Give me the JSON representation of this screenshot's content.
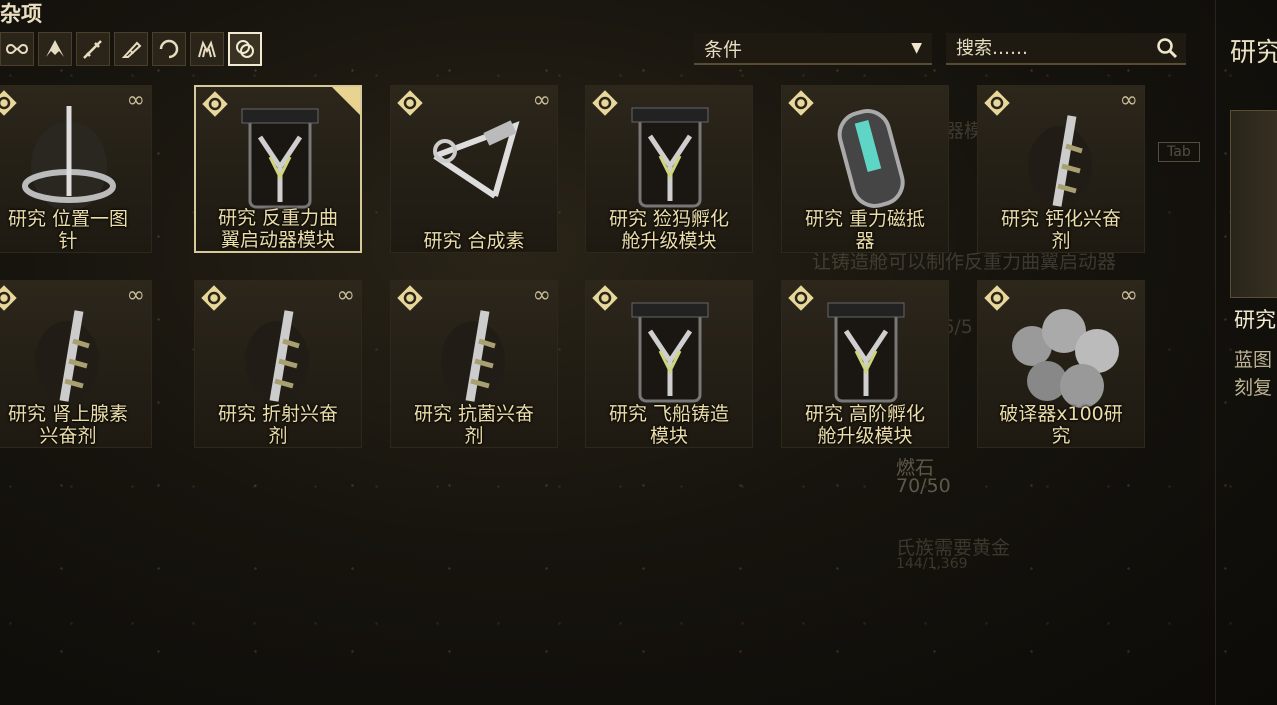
{
  "header": {
    "title": "杂项"
  },
  "filters": [
    {
      "icon": "infinity-icon"
    },
    {
      "icon": "warframe-icon"
    },
    {
      "icon": "primary-weapon-icon"
    },
    {
      "icon": "secondary-weapon-icon"
    },
    {
      "icon": "melee-weapon-icon"
    },
    {
      "icon": "companion-icon"
    },
    {
      "icon": "misc-items-icon",
      "active": true
    }
  ],
  "condition": {
    "label": "条件",
    "arrow": "▼"
  },
  "search": {
    "placeholder": "搜索……"
  },
  "items": [
    {
      "label": "研究  位置一图\n针",
      "art": "beacon-art",
      "infinite": true
    },
    {
      "label": "研究  反重力曲\n翼启动器模块",
      "art": "module-art",
      "infinite": false,
      "selected": true
    },
    {
      "label": "研究  合成素",
      "art": "synthesis-art",
      "infinite": true
    },
    {
      "label": "研究  猃犸孵化\n舱升级模块",
      "art": "module-art",
      "infinite": false
    },
    {
      "label": "研究  重力磁抵\n器",
      "art": "capsule-art",
      "infinite": false
    },
    {
      "label": "研究  钙化兴奋\n剂",
      "art": "syringe-art",
      "infinite": true
    },
    {
      "label": "研究  肾上腺素\n兴奋剂",
      "art": "syringe-art",
      "infinite": true
    },
    {
      "label": "研究  折射兴奋\n剂",
      "art": "syringe-art",
      "infinite": true
    },
    {
      "label": "研究  抗菌兴奋\n剂",
      "art": "syringe-art",
      "infinite": true
    },
    {
      "label": "研究  飞船铸造\n模块",
      "art": "module-art",
      "infinite": false
    },
    {
      "label": "研究  高阶孵化\n舱升级模块",
      "art": "module-art",
      "infinite": false
    },
    {
      "label": "破译器x100研\n究",
      "art": "cipher-art",
      "infinite": true
    }
  ],
  "ghost": {
    "title": "反重力曲翼启动器模块设计图",
    "tab": "Tab",
    "desc": "让铸造舱可以制作反重力曲翼启动器",
    "line1": "5,466/5",
    "line2": "50",
    "resource": "燃石",
    "resource_count": "70/50",
    "line3": "氏族需要黄金",
    "line4": "144/1,369"
  },
  "side": {
    "title": "研究",
    "name": "研究",
    "desc": "蓝图\n刻复"
  },
  "colors": {
    "accent": "#e9d391",
    "text": "#ecdda8",
    "background": "#17140e"
  }
}
